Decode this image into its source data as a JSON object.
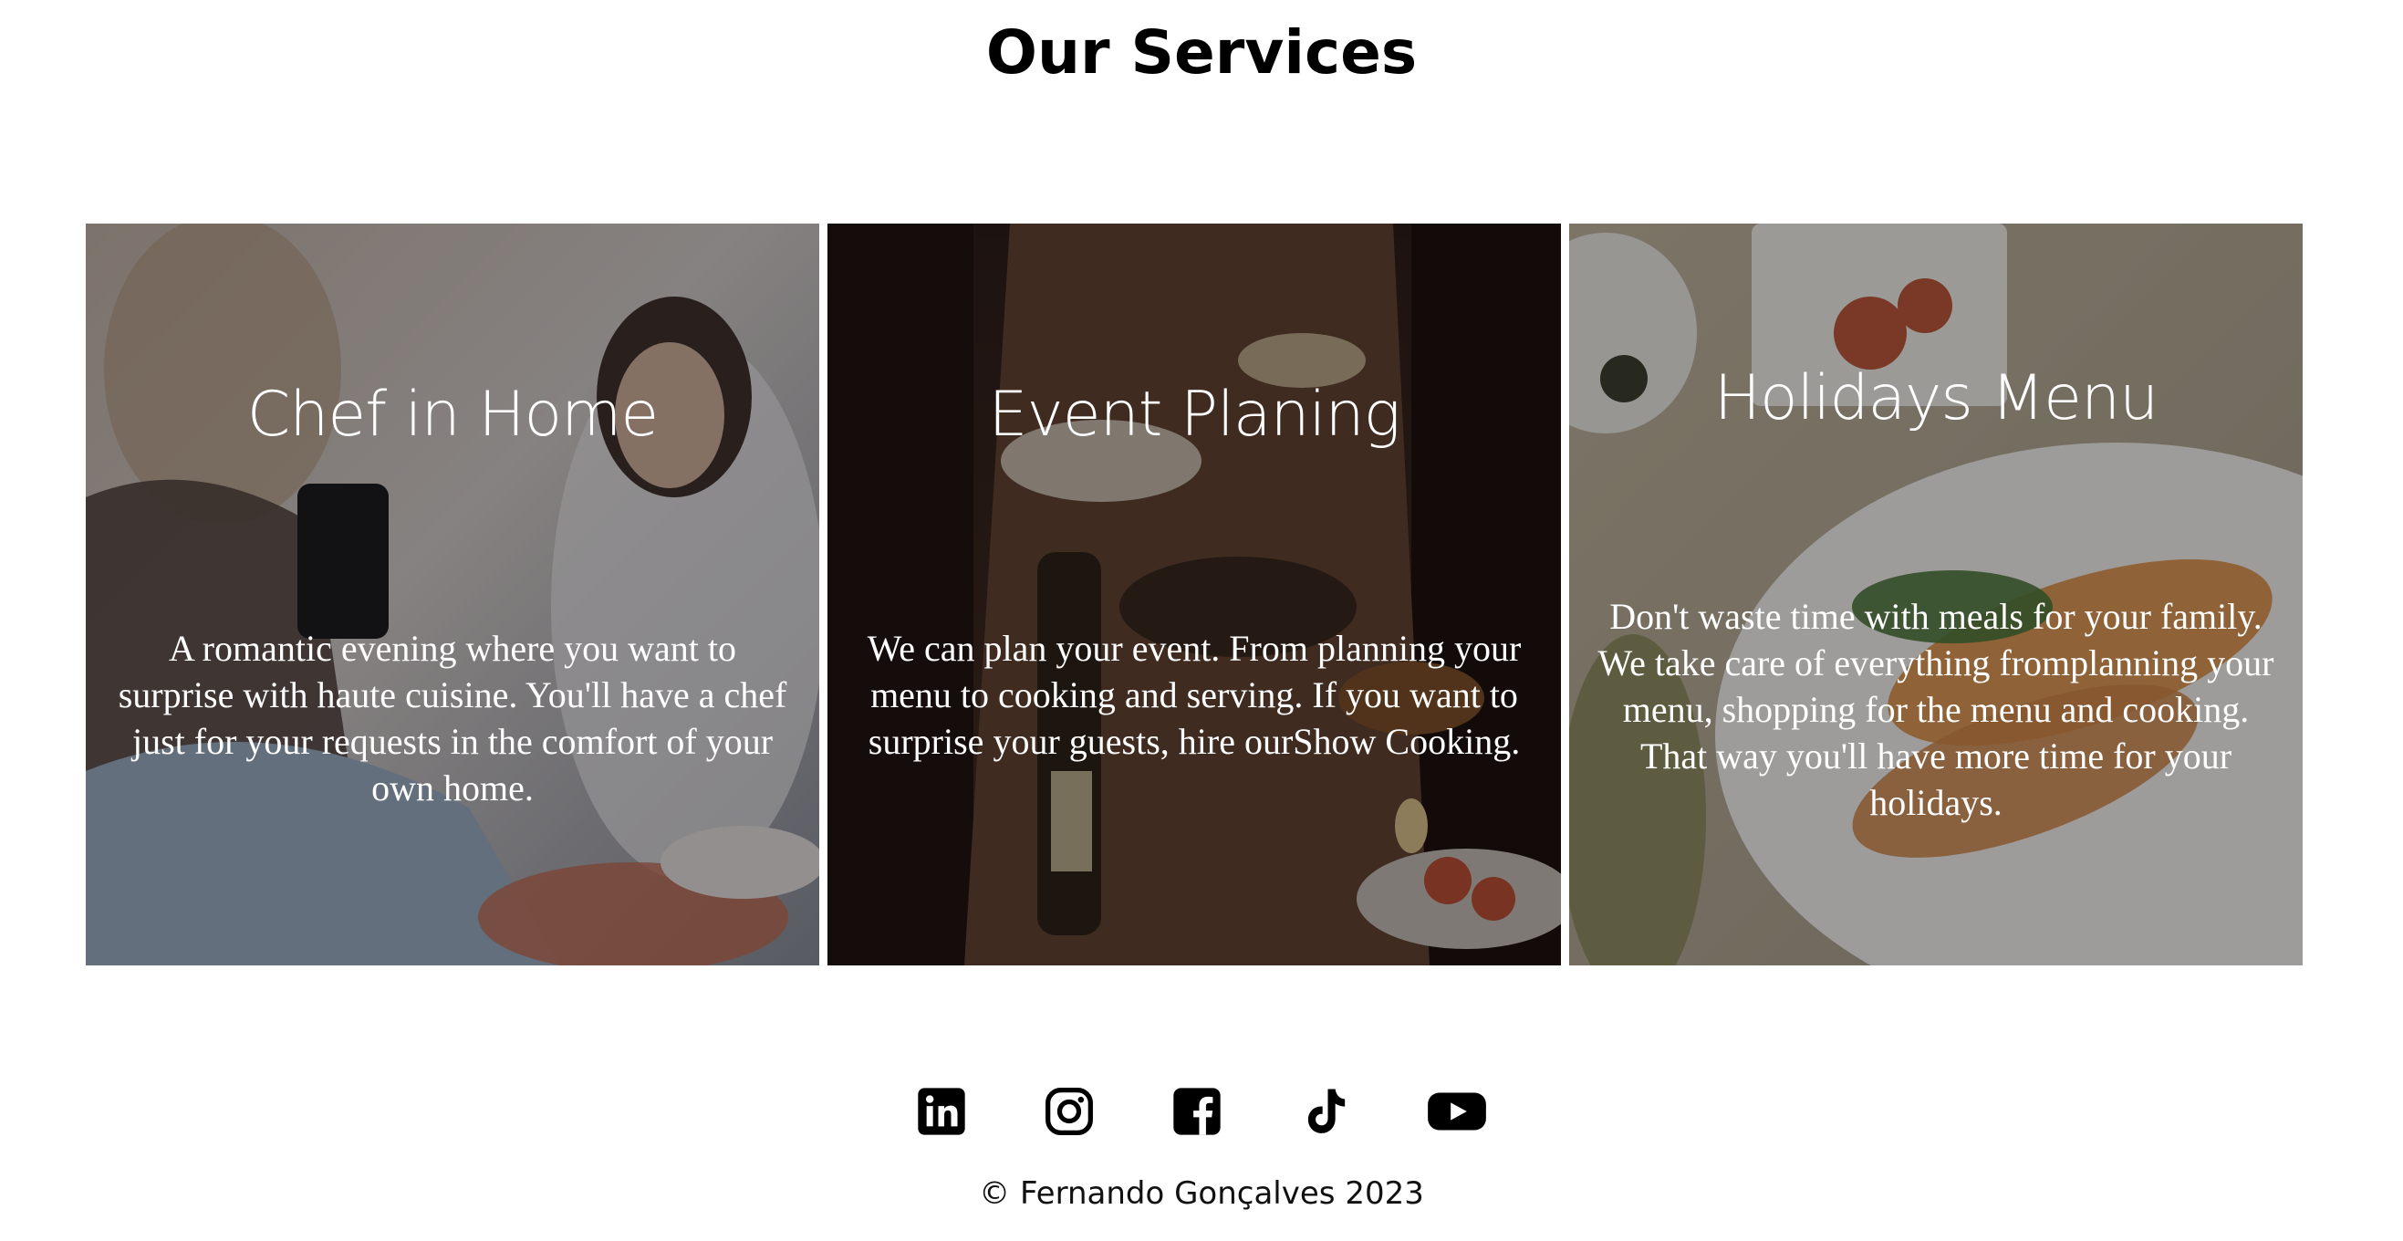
{
  "page": {
    "title": "Our Services"
  },
  "services": [
    {
      "title": "Chef in Home",
      "text": "A romantic evening where you want to surprise with haute cuisine. You'll have a chef just for your requests in the comfort of your own home."
    },
    {
      "title": "Event Planing",
      "text": "We can plan your event. From planning your menu to cooking and serving. If you want to surprise your guests, hire ourShow Cooking."
    },
    {
      "title": "Holidays Menu",
      "text": "Don't waste time with meals for your family. We take care of everything fromplanning your menu, shopping for the menu and cooking. That way you'll have more time for your holidays."
    }
  ],
  "social": [
    {
      "icon": "linkedin-icon"
    },
    {
      "icon": "instagram-icon"
    },
    {
      "icon": "facebook-icon"
    },
    {
      "icon": "tiktok-icon"
    },
    {
      "icon": "youtube-icon"
    }
  ],
  "footer": {
    "copyright": "© Fernando Gonçalves 2023"
  },
  "colors": {
    "text_overlay": "#ffffff",
    "icon": "#000000"
  }
}
